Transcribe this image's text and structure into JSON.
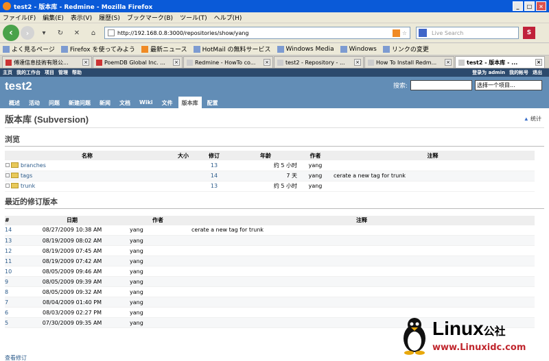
{
  "window": {
    "title": "test2 - 版本库 - Redmine - Mozilla Firefox"
  },
  "menubar": [
    "ファイル(F)",
    "編集(E)",
    "表示(V)",
    "履歴(S)",
    "ブックマーク(B)",
    "ツール(T)",
    "ヘルプ(H)"
  ],
  "nav": {
    "url": "http://192.168.0.8:3000/repositories/show/yang",
    "search_placeholder": "Live Search"
  },
  "bookmarks": [
    "よく見るページ",
    "Firefox を使ってみよう",
    "最新ニュース",
    "HotMail の無料サービス",
    "Windows Media",
    "Windows",
    "リンクの変更"
  ],
  "tabs": [
    "傅達信息技術有限公...",
    "PoemDB Global Inc. ...",
    "Redmine - HowTo co...",
    "test2 - Repository - ...",
    "How To Install Redm...",
    "test2 - 版本库 - ..."
  ],
  "topmenu": {
    "left": [
      "主页",
      "我的工作台",
      "项目",
      "管理",
      "帮助"
    ],
    "right": [
      "登录为 admin",
      "我的帐号",
      "退出"
    ]
  },
  "project": {
    "name": "test2",
    "search_label": "搜索:",
    "jump": "选择一个项目..."
  },
  "mainmenu": [
    "概述",
    "活动",
    "问题",
    "新建问题",
    "新闻",
    "文档",
    "Wiki",
    "文件",
    "版本库",
    "配置"
  ],
  "page": {
    "title": "版本库 (Subversion)",
    "stats": "统计",
    "browse": "浏览",
    "recent": "最近的修订版本",
    "view_all": "查看修订"
  },
  "browse_headers": [
    "名称",
    "大小",
    "修订",
    "年龄",
    "作者",
    "注释"
  ],
  "entries": [
    {
      "name": "branches",
      "rev": "13",
      "age": "约 5 小时",
      "author": "yang",
      "comment": ""
    },
    {
      "name": "tags",
      "rev": "14",
      "age": "7 天",
      "author": "yang",
      "comment": "cerate a new tag for trunk"
    },
    {
      "name": "trunk",
      "rev": "13",
      "age": "约 5 小时",
      "author": "yang",
      "comment": ""
    }
  ],
  "rev_headers": [
    "#",
    "日期",
    "作者",
    "注释"
  ],
  "revisions": [
    {
      "num": "14",
      "date": "08/27/2009 10:38 AM",
      "author": "yang",
      "comment": "cerate a new tag for trunk"
    },
    {
      "num": "13",
      "date": "08/19/2009 08:02 AM",
      "author": "yang",
      "comment": ""
    },
    {
      "num": "12",
      "date": "08/19/2009 07:45 AM",
      "author": "yang",
      "comment": ""
    },
    {
      "num": "11",
      "date": "08/19/2009 07:42 AM",
      "author": "yang",
      "comment": ""
    },
    {
      "num": "10",
      "date": "08/05/2009 09:46 AM",
      "author": "yang",
      "comment": ""
    },
    {
      "num": "9",
      "date": "08/05/2009 09:39 AM",
      "author": "yang",
      "comment": ""
    },
    {
      "num": "8",
      "date": "08/05/2009 09:32 AM",
      "author": "yang",
      "comment": ""
    },
    {
      "num": "7",
      "date": "08/04/2009 01:40 PM",
      "author": "yang",
      "comment": ""
    },
    {
      "num": "6",
      "date": "08/03/2009 02:27 PM",
      "author": "yang",
      "comment": ""
    },
    {
      "num": "5",
      "date": "07/30/2009 09:35 AM",
      "author": "yang",
      "comment": ""
    }
  ],
  "watermark": {
    "brand": "Linux",
    "suffix": "公社",
    "site": "www.Linuxidc.com"
  }
}
